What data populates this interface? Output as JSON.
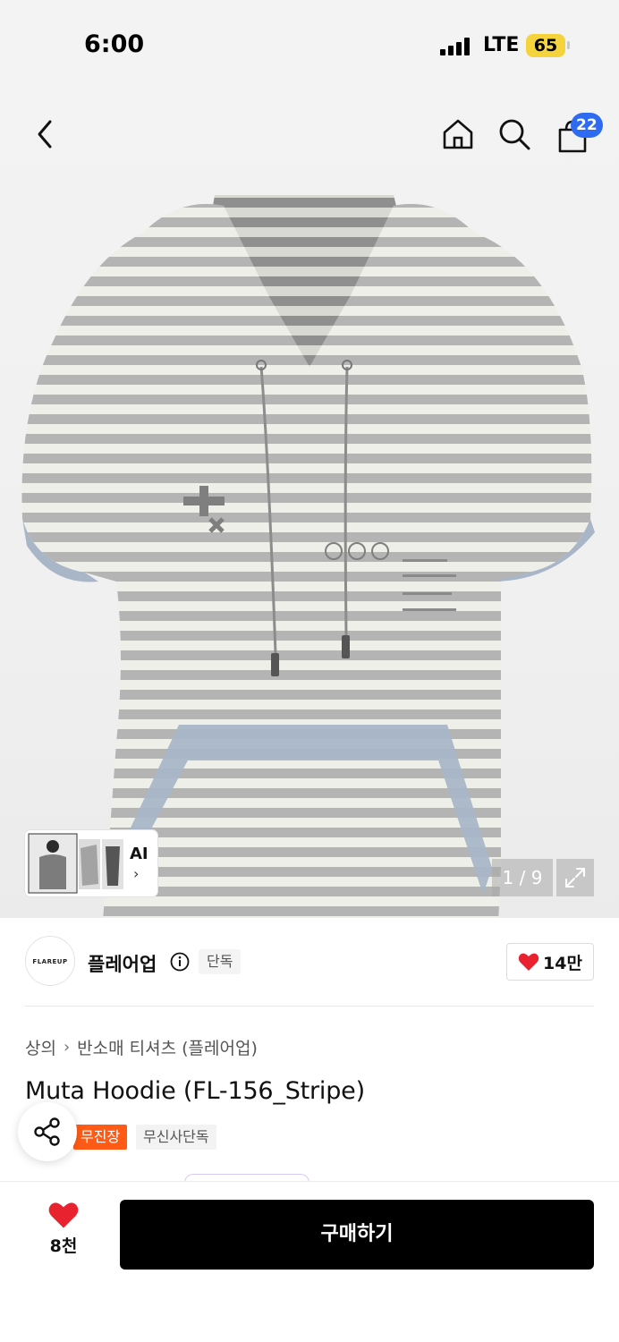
{
  "status_bar": {
    "time": "6:00",
    "network": "LTE",
    "battery": "65"
  },
  "nav": {
    "cart_count": "22"
  },
  "gallery": {
    "ai_label": "AI",
    "pager": "1 / 9"
  },
  "brand": {
    "logo_text": "FLAREUP",
    "name": "플레어업",
    "exclusive_tag": "단독",
    "likes": "14만"
  },
  "breadcrumb": [
    "상의",
    "반소매 티셔츠 (플레어업)"
  ],
  "product": {
    "title": "Muta Hoodie (FL-156_Stripe)",
    "tags": [
      "무진장",
      "무신사단독"
    ]
  },
  "bottom": {
    "wish_count": "8천",
    "buy_label": "구매하기"
  },
  "colors": {
    "accent_blue": "#2f6bf1",
    "tag_orange": "#ff5b16",
    "like_red": "#e8232f",
    "buy_black": "#000000"
  }
}
